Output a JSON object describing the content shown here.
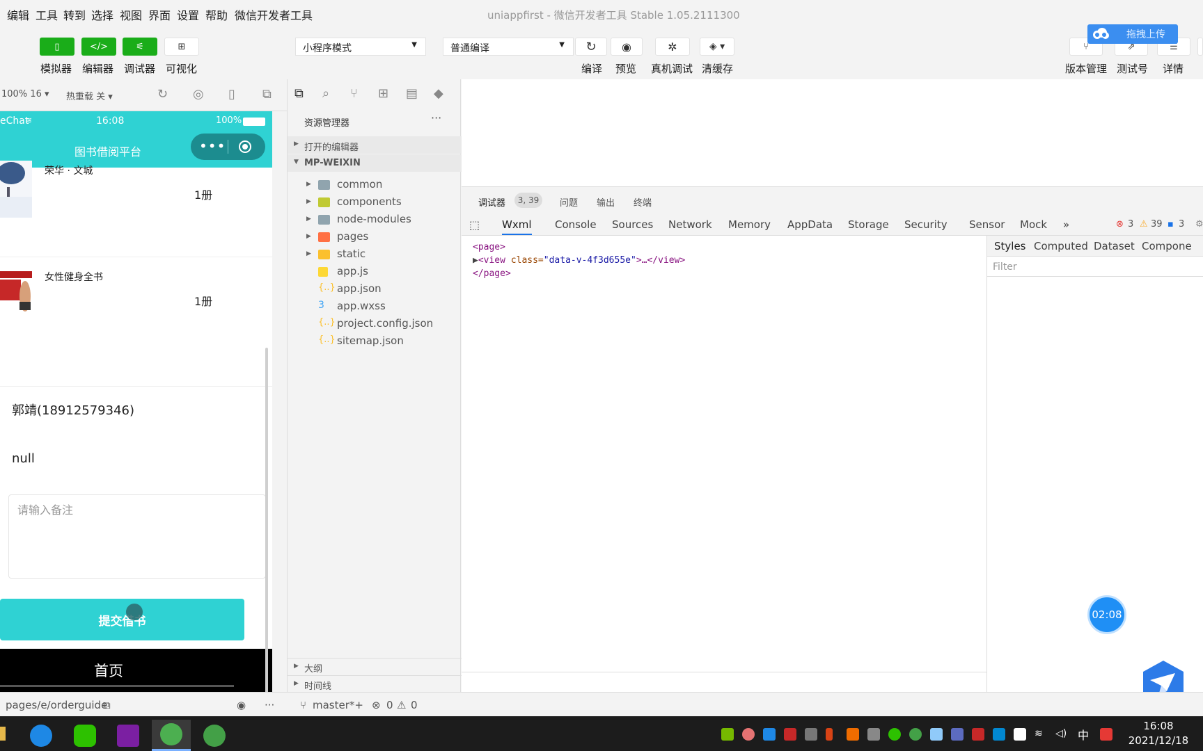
{
  "menu": [
    "编辑",
    "工具",
    "转到",
    "选择",
    "视图",
    "界面",
    "设置",
    "帮助",
    "微信开发者工具"
  ],
  "window_title": "uniappfirst - 微信开发者工具 Stable 1.05.2111300",
  "toolbar": {
    "simulator": "模拟器",
    "editor": "编辑器",
    "debugger": "调试器",
    "visual": "可视化",
    "mode_select": "小程序模式",
    "compile_select": "普通编译",
    "compile": "编译",
    "preview": "预览",
    "remote_debug": "真机调试",
    "clear_cache": "清缓存",
    "version": "版本管理",
    "test_account": "测试号",
    "details": "详情",
    "upload_badge": "拖拽上传"
  },
  "sim_subbar": {
    "zoom": "100% 16 ▾",
    "hot_reload": "热重载 关 ▾"
  },
  "phone": {
    "carrier": "eChat",
    "time": "16:08",
    "battery": "100%",
    "title": "图书借阅平台",
    "books": [
      {
        "name": "荣华 · 文城",
        "qty": "1册"
      },
      {
        "name": "女性健身全书",
        "qty": "1册"
      }
    ],
    "contact": "郭靖(18912579346)",
    "address": "null",
    "remark_placeholder": "请输入备注",
    "submit": "提交借书",
    "tab_home": "首页"
  },
  "explorer": {
    "header": "资源管理器",
    "more": "···",
    "open_editors": "打开的编辑器",
    "root": "MP-WEIXIN",
    "items": [
      {
        "name": "common",
        "type": "folder",
        "color": "#90a4ae"
      },
      {
        "name": "components",
        "type": "folder",
        "color": "#c0ca33"
      },
      {
        "name": "node-modules",
        "type": "folder",
        "color": "#90a4ae"
      },
      {
        "name": "pages",
        "type": "folder",
        "color": "#ff7043"
      },
      {
        "name": "static",
        "type": "folder",
        "color": "#fbc02d"
      },
      {
        "name": "app.js",
        "type": "file",
        "color": "#fdd835"
      },
      {
        "name": "app.json",
        "type": "file",
        "color": "#fbc02d"
      },
      {
        "name": "app.wxss",
        "type": "file",
        "color": "#42a5f5"
      },
      {
        "name": "project.config.json",
        "type": "file",
        "color": "#fbc02d"
      },
      {
        "name": "sitemap.json",
        "type": "file",
        "color": "#fbc02d"
      }
    ],
    "outline": "大纲",
    "timeline": "时间线"
  },
  "debugger": {
    "tab_debugger": "调试器",
    "badge": "3, 39",
    "tab_issues": "问题",
    "tab_output": "输出",
    "tab_terminal": "终端",
    "devtools_tabs": [
      "Wxml",
      "Console",
      "Sources",
      "Network",
      "Memory",
      "AppData",
      "Storage",
      "Security",
      "Sensor",
      "Mock"
    ],
    "more_tabs": "»",
    "errors": "3",
    "warnings": "39",
    "infos": "3",
    "wxml_open": "<page>",
    "wxml_view_tag": "<view",
    "wxml_attr": " class=",
    "wxml_val": "\"data-v-4f3d655e\"",
    "wxml_view_end": ">…</view>",
    "wxml_close": "</page>",
    "styles_tabs": [
      "Styles",
      "Computed",
      "Dataset",
      "Compone"
    ],
    "filter_placeholder": "Filter"
  },
  "timer": "02:08",
  "statusbar": {
    "path": "pages/e/orderguide",
    "branch": "master*+",
    "errors": "0",
    "warnings": "0",
    "more": "···"
  },
  "clock": {
    "time": "16:08",
    "date": "2021/12/18"
  },
  "ime": "中",
  "colors": {
    "accent": "#2fd2d3",
    "green": "#1aad19",
    "blue": "#1a73e8"
  }
}
